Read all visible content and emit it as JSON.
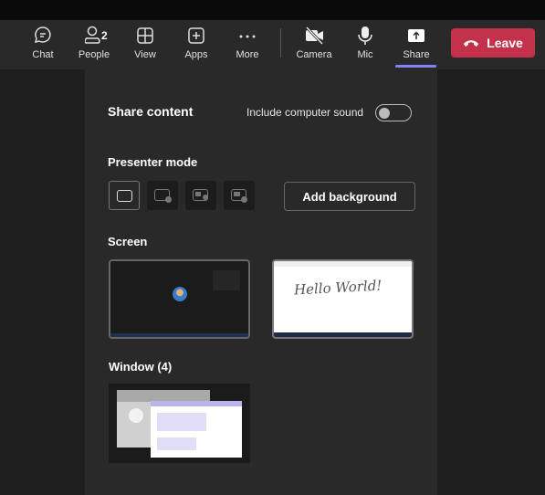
{
  "toolbar": {
    "items": [
      {
        "label": "Chat",
        "icon": "chat-icon"
      },
      {
        "label": "People",
        "icon": "people-icon",
        "badge": "2"
      },
      {
        "label": "View",
        "icon": "grid-icon"
      },
      {
        "label": "Apps",
        "icon": "plus-square-icon"
      },
      {
        "label": "More",
        "icon": "more-icon"
      },
      {
        "label": "Camera",
        "icon": "camera-off-icon"
      },
      {
        "label": "Mic",
        "icon": "mic-icon"
      },
      {
        "label": "Share",
        "icon": "share-icon",
        "active": true
      }
    ],
    "leave_label": "Leave",
    "leave_color": "#c4314b",
    "accent": "#7f85f5"
  },
  "panel": {
    "title": "Share content",
    "sound_label": "Include computer sound",
    "sound_on": false,
    "presenter_title": "Presenter mode",
    "add_background": "Add background",
    "screen_title": "Screen",
    "screen2_text": "Hello World!",
    "window_title": "Window (4)"
  }
}
